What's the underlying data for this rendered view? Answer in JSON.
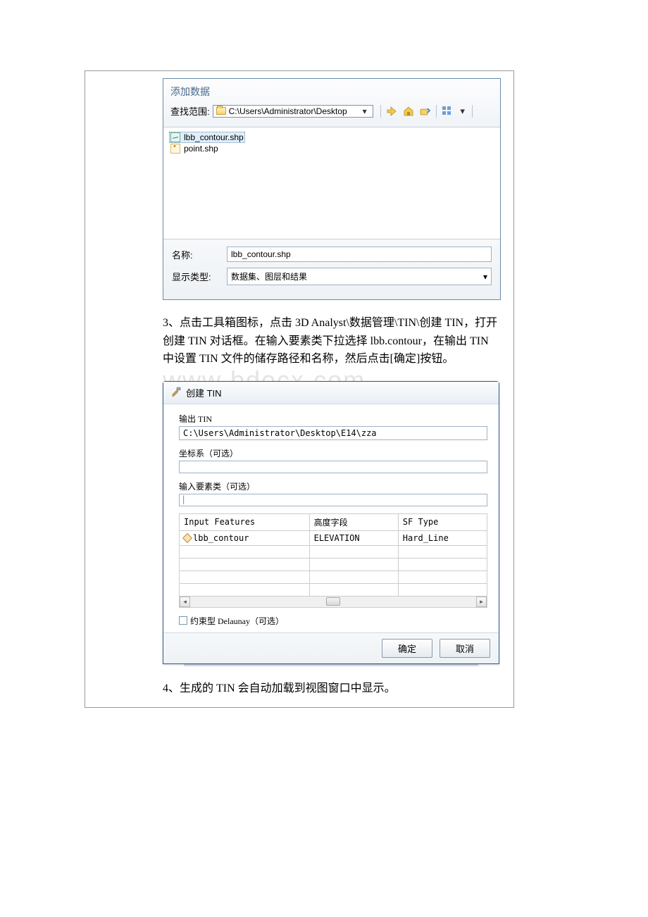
{
  "addData": {
    "title": "添加数据",
    "lookupLabel": "查找范围:",
    "lookupPath": "C:\\Users\\Administrator\\Desktop",
    "files": [
      {
        "name": "lbb_contour.shp",
        "selected": true,
        "iconType": "line"
      },
      {
        "name": "point.shp",
        "selected": false,
        "iconType": "point"
      }
    ],
    "nameLabel": "名称:",
    "nameValue": "lbb_contour.shp",
    "typeLabel": "显示类型:",
    "typeValue": "数据集、图层和结果",
    "icons": {
      "up": "up-level-icon",
      "home": "home-icon",
      "connect": "connect-folder-icon",
      "grid": "view-grid-icon",
      "dropdown": "dropdown-icon"
    }
  },
  "paragraph3": "3、点击工具箱图标，点击 3D Analyst\\数据管理\\TIN\\创建 TIN，打开创建 TIN 对话框。在输入要素类下拉选择 lbb.contour，在输出 TIN 中设置 TIN 文件的储存路径和名称，然后点击[确定]按钮。",
  "watermark": "www    bdocx com",
  "createTin": {
    "title": "创建 TIN",
    "outputLabel": "输出 TIN",
    "outputValue": "C:\\Users\\Administrator\\Desktop\\E14\\zza",
    "coordLabel": "坐标系（可选）",
    "coordValue": "",
    "featLabel": "输入要素类（可选）",
    "featInputValue": "",
    "table": {
      "headers": [
        "Input Features",
        "高度字段",
        "SF Type"
      ],
      "row": [
        "lbb_contour",
        "ELEVATION",
        "Hard_Line"
      ]
    },
    "constraintLabel": "约束型 Delaunay（可选）",
    "okLabel": "确定",
    "cancelLabel": "取消"
  },
  "paragraph4": "4、生成的 TIN 会自动加载到视图窗口中显示。"
}
